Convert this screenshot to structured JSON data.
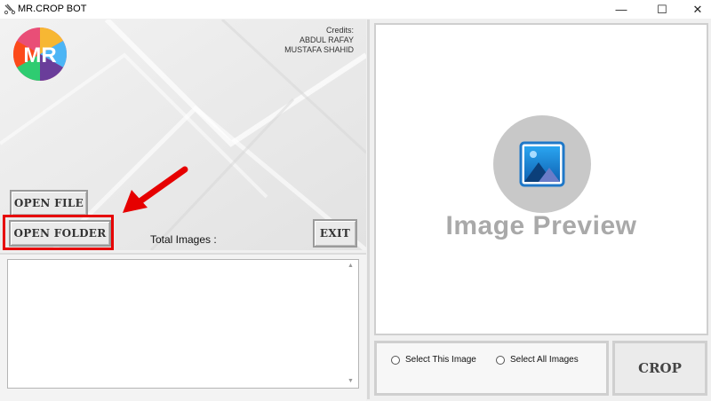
{
  "window": {
    "title": "MR.CROP BOT",
    "minimize_glyph": "—",
    "maximize_glyph": "☐",
    "close_glyph": "✕"
  },
  "credits": {
    "heading": "Credits:",
    "line1": "ABDUL RAFAY",
    "line2": "MUSTAFA SHAHID"
  },
  "logo": {
    "text": "MR"
  },
  "buttons": {
    "open_file": "OPEN FILE",
    "open_folder": "OPEN FOLDER",
    "exit": "EXIT",
    "crop": "CROP"
  },
  "status": {
    "total_images_label": "Total Images :"
  },
  "preview": {
    "placeholder_text": "Image Preview",
    "icon": "image-icon"
  },
  "options": {
    "select_this": "Select This Image",
    "select_all": "Select All Images"
  },
  "colors": {
    "highlight": "#e60000",
    "arrow": "#e60000",
    "preview_text": "#a9a9a9",
    "icon_blue": "#1f78c8"
  }
}
